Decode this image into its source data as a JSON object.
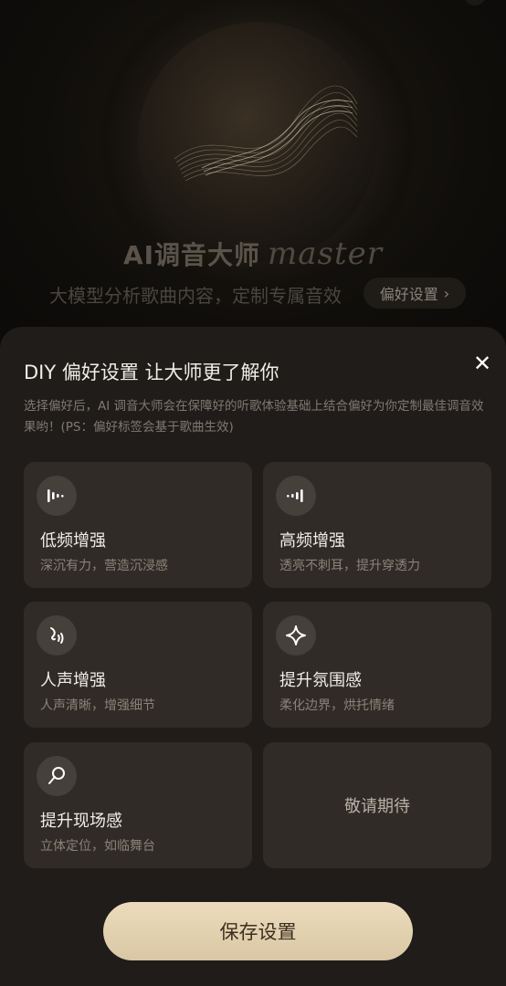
{
  "hero": {
    "title_cn": "AI调音大师",
    "title_en": "master",
    "subtitle": "大模型分析歌曲内容，定制专属音效",
    "pref_button": "偏好设置",
    "pref_button_chevron": "›"
  },
  "sheet": {
    "title": "DIY 偏好设置 让大师更了解你",
    "close_label": "✕",
    "description": "选择偏好后，AI 调音大师会在保障好的听歌体验基础上结合偏好为你定制最佳调音效果哟！(PS：偏好标签会基于歌曲生效)",
    "options": [
      {
        "name": "低频增强",
        "desc": "深沉有力，营造沉浸感",
        "icon": "low-frequency-icon"
      },
      {
        "name": "高频增强",
        "desc": "透亮不刺耳，提升穿透力",
        "icon": "high-frequency-icon"
      },
      {
        "name": "人声增强",
        "desc": "人声清晰，增强细节",
        "icon": "voice-icon"
      },
      {
        "name": "提升氛围感",
        "desc": "柔化边界，烘托情绪",
        "icon": "sparkle-icon"
      },
      {
        "name": "提升现场感",
        "desc": "立体定位，如临舞台",
        "icon": "microphone-icon"
      }
    ],
    "coming_soon": "敬请期待",
    "save_label": "保存设置"
  }
}
